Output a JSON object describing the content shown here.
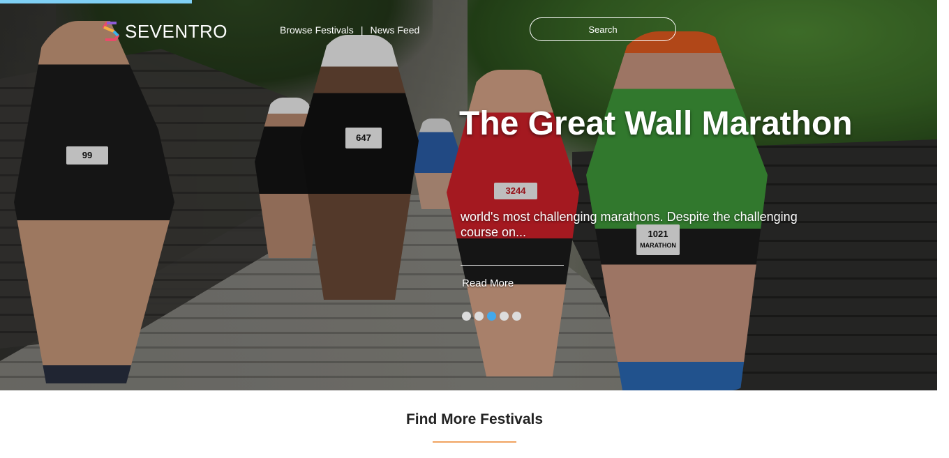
{
  "brand": {
    "name": "SEVENTRO"
  },
  "nav": {
    "items": [
      "Browse Festivals",
      "News Feed"
    ],
    "separator": "|"
  },
  "search": {
    "placeholder": "Search"
  },
  "hero": {
    "title": "The Great Wall Marathon",
    "excerpt": "world's most challenging marathons. Despite the challenging course on...",
    "read_more_label": "Read More",
    "slide_count": 5,
    "active_slide_index": 2,
    "bibs": [
      "99",
      "647",
      "3244",
      "1021"
    ],
    "bib_label": "MARATHON"
  },
  "section": {
    "title": "Find More Festivals"
  },
  "colors": {
    "accent_blue": "#43a8ea",
    "accent_orange": "#f0a360",
    "top_bar": "#7fd0f5"
  }
}
